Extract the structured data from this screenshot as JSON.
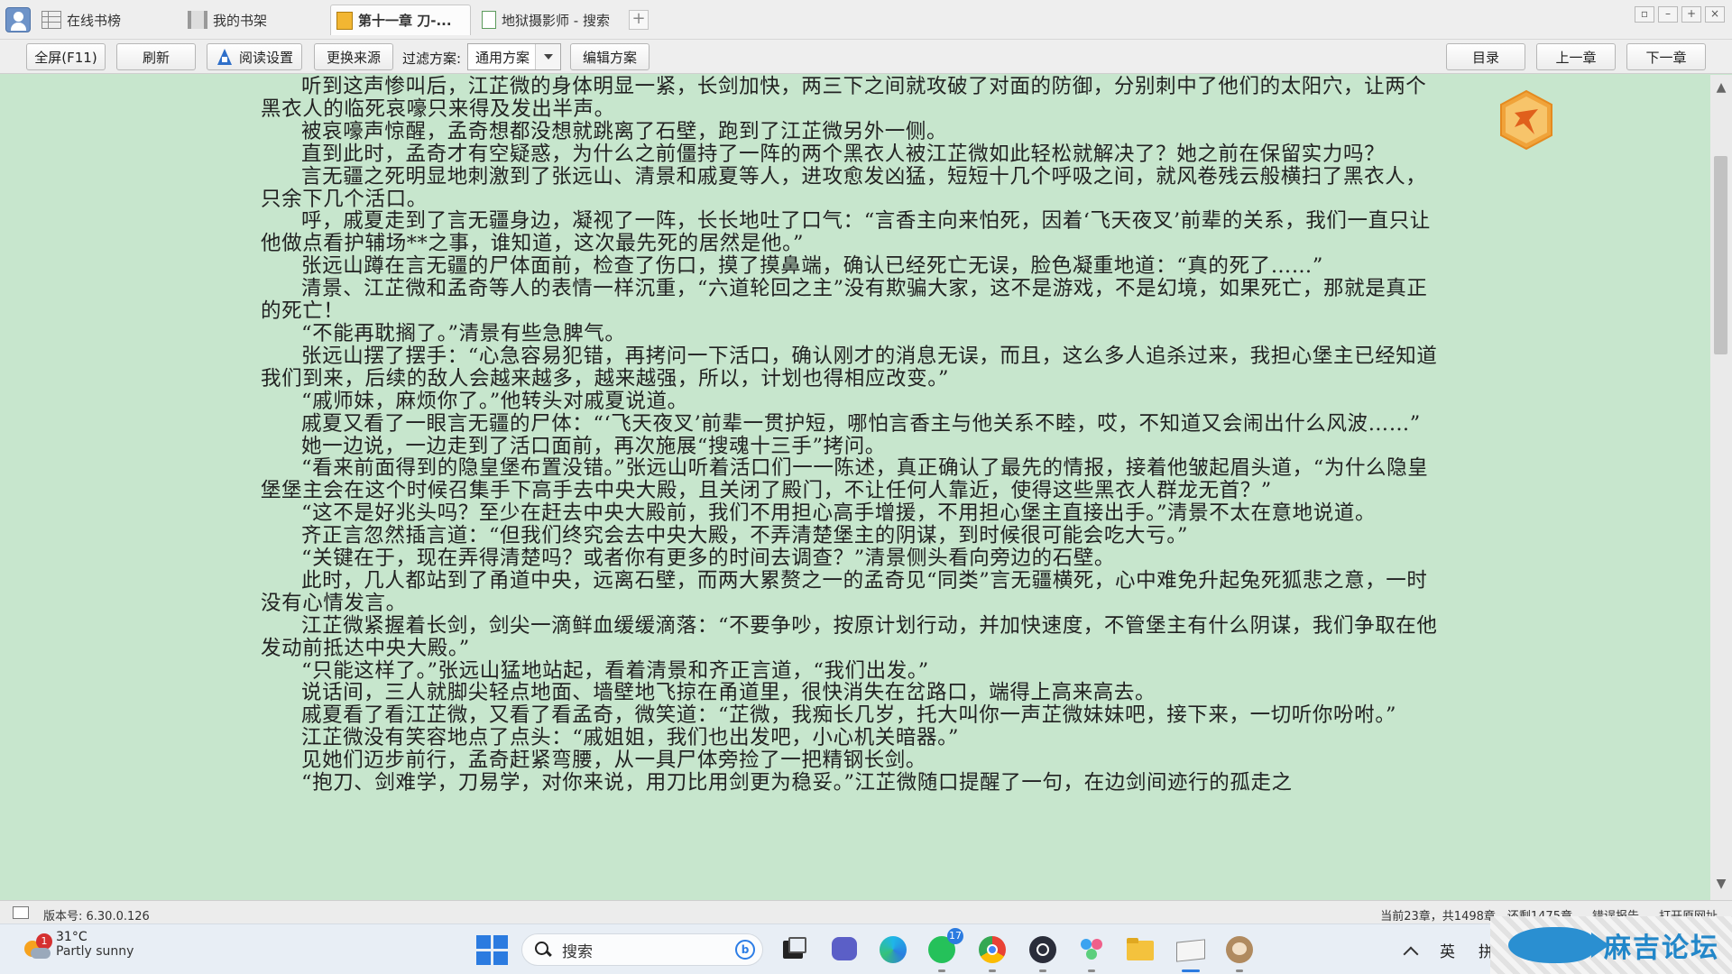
{
  "tabs": [
    {
      "label": "在线书榜",
      "icon": "grid-list-icon"
    },
    {
      "label": "我的书架",
      "icon": "bookshelf-icon"
    },
    {
      "label": "第十一章 刀-...",
      "icon": "book-icon",
      "active": true
    },
    {
      "label": "地狱摄影师 - 搜索",
      "icon": "page-icon"
    }
  ],
  "tab_add": "+",
  "toolbar": {
    "fullscreen": "全屏(F11)",
    "refresh": "刷新",
    "reading_settings": "阅读设置",
    "change_source": "更换来源",
    "filter_label": "过滤方案:",
    "filter_value": "通用方案",
    "edit_scheme": "编辑方案",
    "toc": "目录",
    "prev_chapter": "上一章",
    "next_chapter": "下一章"
  },
  "content": {
    "paragraphs": [
      "听到这声惨叫后，江芷微的身体明显一紧，长剑加快，两三下之间就攻破了对面的防御，分别刺中了他们的太阳穴，让两个黑衣人的临死哀嚎只来得及发出半声。",
      "被哀嚎声惊醒，孟奇想都没想就跳离了石壁，跑到了江芷微另外一侧。",
      "直到此时，孟奇才有空疑惑，为什么之前僵持了一阵的两个黑衣人被江芷微如此轻松就解决了？她之前在保留实力吗？",
      "言无疆之死明显地刺激到了张远山、清景和戚夏等人，进攻愈发凶猛，短短十几个呼吸之间，就风卷残云般横扫了黑衣人，只余下几个活口。",
      "呼，戚夏走到了言无疆身边，凝视了一阵，长长地吐了口气：“言香主向来怕死，因着‘飞天夜叉’前辈的关系，我们一直只让他做点看护辅场**之事，谁知道，这次最先死的居然是他。”",
      "张远山蹲在言无疆的尸体面前，检查了伤口，摸了摸鼻端，确认已经死亡无误，脸色凝重地道：“真的死了……”",
      "清景、江芷微和孟奇等人的表情一样沉重，“六道轮回之主”没有欺骗大家，这不是游戏，不是幻境，如果死亡，那就是真正的死亡！",
      "“不能再耽搁了。”清景有些急脾气。",
      "张远山摆了摆手：“心急容易犯错，再拷问一下活口，确认刚才的消息无误，而且，这么多人追杀过来，我担心堡主已经知道我们到来，后续的敌人会越来越多，越来越强，所以，计划也得相应改变。”",
      "“戚师妹，麻烦你了。”他转头对戚夏说道。",
      "戚夏又看了一眼言无疆的尸体：“‘飞天夜叉’前辈一贯护短，哪怕言香主与他关系不睦，哎，不知道又会闹出什么风波……”",
      "她一边说，一边走到了活口面前，再次施展“搜魂十三手”拷问。",
      "“看来前面得到的隐皇堡布置没错。”张远山听着活口们一一陈述，真正确认了最先的情报，接着他皱起眉头道，“为什么隐皇堡堡主会在这个时候召集手下高手去中央大殿，且关闭了殿门，不让任何人靠近，使得这些黑衣人群龙无首？”",
      "“这不是好兆头吗？至少在赶去中央大殿前，我们不用担心高手增援，不用担心堡主直接出手。”清景不太在意地说道。",
      "齐正言忽然插言道：“但我们终究会去中央大殿，不弄清楚堡主的阴谋，到时候很可能会吃大亏。”",
      "“关键在于，现在弄得清楚吗？或者你有更多的时间去调查？”清景侧头看向旁边的石壁。",
      "此时，几人都站到了甬道中央，远离石壁，而两大累赘之一的孟奇见“同类”言无疆横死，心中难免升起兔死狐悲之意，一时没有心情发言。",
      "江芷微紧握着长剑，剑尖一滴鲜血缓缓滴落：“不要争吵，按原计划行动，并加快速度，不管堡主有什么阴谋，我们争取在他发动前抵达中央大殿。”",
      "“只能这样了。”张远山猛地站起，看着清景和齐正言道，“我们出发。”",
      "说话间，三人就脚尖轻点地面、墙壁地飞掠在甬道里，很快消失在岔路口，端得上高来高去。",
      "戚夏看了看江芷微，又看了看孟奇，微笑道：“芷微，我痴长几岁，托大叫你一声芷微妹妹吧，接下来，一切听你吩咐。”",
      "江芷微没有笑容地点了点头：“戚姐姐，我们也出发吧，小心机关暗器。”",
      "见她们迈步前行，孟奇赶紧弯腰，从一具尸体旁捡了一把精钢长剑。",
      "“抱刀、剑难学，刀易学，对你来说，用刀比用剑更为稳妥。”江芷微随口提醒了一句，在边剑间迹行的孤走之"
    ]
  },
  "statusbar": {
    "version": "版本号: 6.30.0.126",
    "chapter_info": "当前23章，共1498章，还剩1475章",
    "error_report": "错误报告",
    "open_original": "打开原网址"
  },
  "taskbar": {
    "weather_temp": "31°C",
    "weather_desc": "Partly sunny",
    "weather_badge": "1",
    "search_placeholder": "搜索",
    "whatsapp_badge": "17",
    "ime": "英",
    "ime2": "拼"
  },
  "watermark": "麻吉论坛",
  "colors": {
    "reader_bg": "#c7e6cd",
    "accent": "#2b7be0"
  }
}
